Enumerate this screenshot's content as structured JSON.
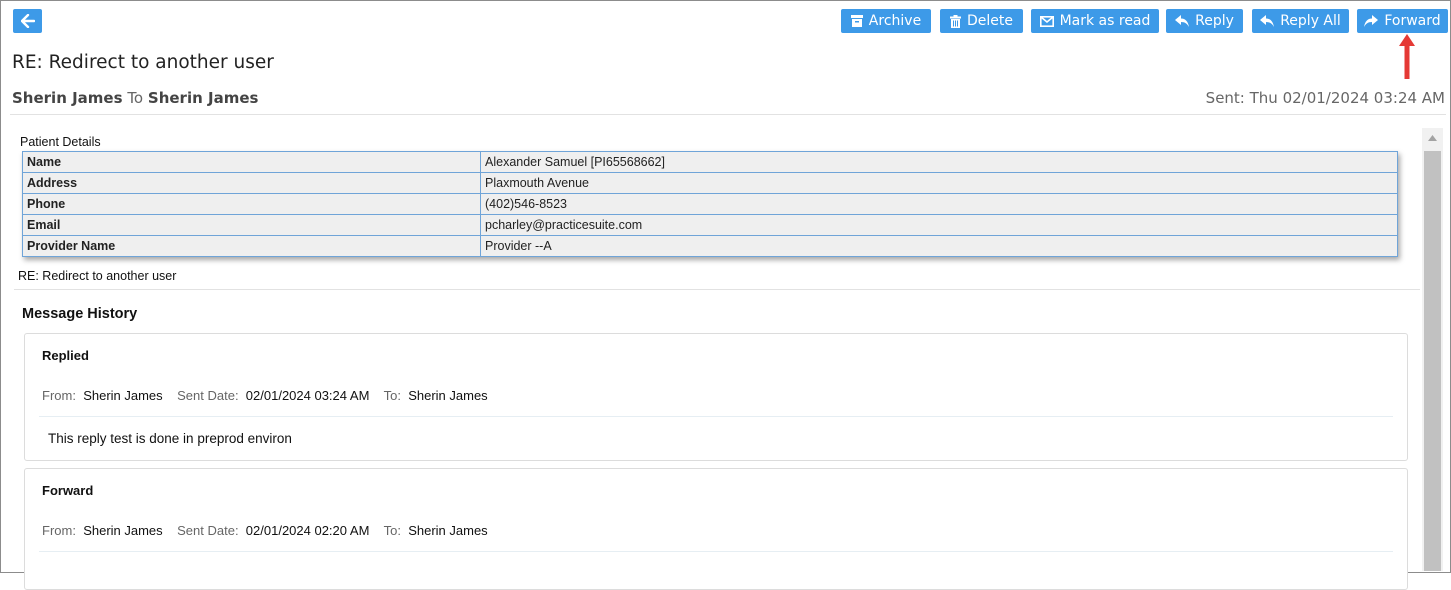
{
  "toolbar": {
    "back_icon": "arrow-left-icon",
    "buttons": [
      {
        "label": "Archive",
        "icon": "archive-icon"
      },
      {
        "label": "Delete",
        "icon": "trash-icon"
      },
      {
        "label": "Mark as read",
        "icon": "envelope-icon"
      },
      {
        "label": "Reply",
        "icon": "reply-icon"
      },
      {
        "label": "Reply All",
        "icon": "reply-all-icon"
      },
      {
        "label": "Forward",
        "icon": "forward-icon"
      }
    ],
    "accent_color": "#3d9ae8",
    "highlight_arrow_color": "#e53935"
  },
  "message": {
    "subject": "RE: Redirect to another user",
    "from": "Sherin James",
    "to_word": "To",
    "to": "Sherin James",
    "sent": "Sent: Thu 02/01/2024 03:24 AM"
  },
  "patient_details": {
    "label": "Patient Details",
    "rows": [
      {
        "key": "Name",
        "value": "Alexander Samuel [PI65568662]"
      },
      {
        "key": "Address",
        "value": "Plaxmouth Avenue"
      },
      {
        "key": "Phone",
        "value": "(402)546-8523"
      },
      {
        "key": "Email",
        "value": "pcharley@practicesuite.com"
      },
      {
        "key": "Provider Name",
        "value": "Provider --A"
      }
    ],
    "subject_line": "RE: Redirect to another user"
  },
  "history": {
    "title": "Message History",
    "labels": {
      "from": "From:",
      "sent_date": "Sent Date:",
      "to": "To:"
    },
    "items": [
      {
        "type": "Replied",
        "from": "Sherin James",
        "sent_date": "02/01/2024 03:24 AM",
        "to": "Sherin James",
        "body": "This reply test is done in preprod environ"
      },
      {
        "type": "Forward",
        "from": "Sherin James",
        "sent_date": "02/01/2024 02:20 AM",
        "to": "Sherin James",
        "body": ""
      }
    ]
  }
}
